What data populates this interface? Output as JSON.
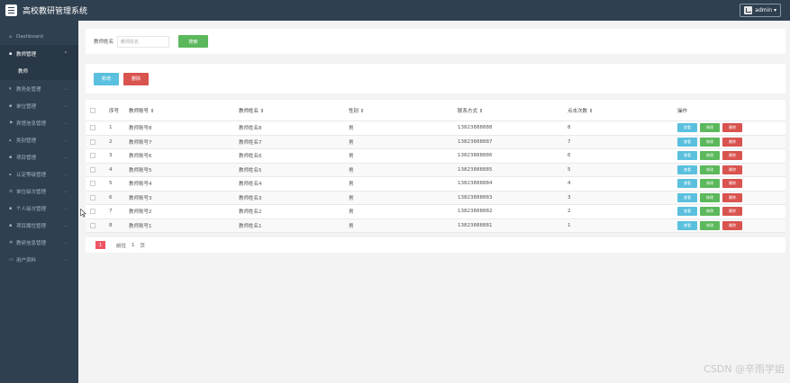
{
  "app": {
    "title": "高校教研管理系统",
    "user": "admin ▾"
  },
  "sidebar": {
    "items": [
      {
        "label": "Dashboard",
        "icon": "home-icon"
      },
      {
        "label": "教师管理",
        "icon": "grid-icon"
      },
      {
        "label": "教师",
        "icon": ""
      },
      {
        "label": "教务处管理",
        "icon": "filter-icon"
      },
      {
        "label": "单位管理",
        "icon": "building-icon"
      },
      {
        "label": "宾馆信息管理",
        "icon": "flag-icon"
      },
      {
        "label": "类别管理",
        "icon": "user-icon"
      },
      {
        "label": "项目管理",
        "icon": "list-icon"
      },
      {
        "label": "认定等级管理",
        "icon": "user-icon"
      },
      {
        "label": "单位级次管理",
        "icon": "menu-icon"
      },
      {
        "label": "个人级次管理",
        "icon": "grid-icon"
      },
      {
        "label": "项目属性管理",
        "icon": "list-icon"
      },
      {
        "label": "教研信息管理",
        "icon": "gear-icon"
      },
      {
        "label": "用户资料",
        "icon": "card-icon"
      }
    ]
  },
  "search": {
    "label": "教师姓名",
    "placeholder": "教师姓名",
    "button": "搜索"
  },
  "actions": {
    "add": "新增",
    "delete": "删除"
  },
  "table": {
    "headers": [
      "序号",
      "教师账号 ⇕",
      "教师姓名 ⇕",
      "性别 ⇕",
      "联系方式 ⇕",
      "点击次数 ⇕",
      "操作"
    ],
    "rows": [
      {
        "idx": "1",
        "account": "教师账号8",
        "name": "教师姓名8",
        "gender": "男",
        "phone": "13823888888",
        "clicks": "8"
      },
      {
        "idx": "2",
        "account": "教师账号7",
        "name": "教师姓名7",
        "gender": "男",
        "phone": "13823888887",
        "clicks": "7"
      },
      {
        "idx": "3",
        "account": "教师账号6",
        "name": "教师姓名6",
        "gender": "男",
        "phone": "13823888886",
        "clicks": "6"
      },
      {
        "idx": "4",
        "account": "教师账号5",
        "name": "教师姓名5",
        "gender": "男",
        "phone": "13823888885",
        "clicks": "5"
      },
      {
        "idx": "5",
        "account": "教师账号4",
        "name": "教师姓名4",
        "gender": "男",
        "phone": "13823888884",
        "clicks": "4"
      },
      {
        "idx": "6",
        "account": "教师账号3",
        "name": "教师姓名3",
        "gender": "男",
        "phone": "13823888883",
        "clicks": "3"
      },
      {
        "idx": "7",
        "account": "教师账号2",
        "name": "教师姓名2",
        "gender": "男",
        "phone": "13823888882",
        "clicks": "2"
      },
      {
        "idx": "8",
        "account": "教师账号1",
        "name": "教师姓名1",
        "gender": "男",
        "phone": "13823888881",
        "clicks": "1"
      }
    ],
    "row_actions": {
      "view": "查看",
      "edit": "修改",
      "delete": "删除"
    }
  },
  "pager": {
    "page": "1",
    "goto": "前往",
    "current": "1",
    "unit": "页"
  },
  "watermark": "CSDN @辛雨学姐",
  "colors": {
    "sidebar": "#2f4050",
    "green": "#5cb85c",
    "cyan": "#5bc0de",
    "red": "#d9534f",
    "page": "#ed5565"
  }
}
